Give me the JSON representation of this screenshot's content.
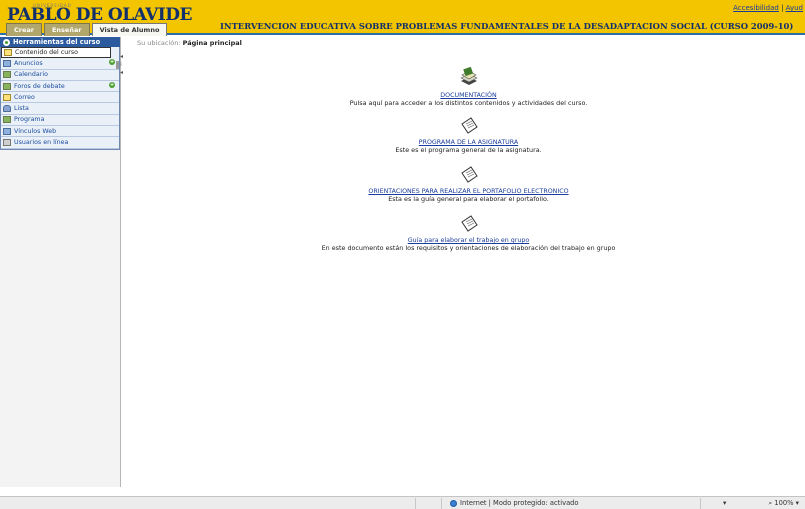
{
  "header": {
    "logo_small": "UNIVERSIDAD",
    "logo_text": "PABLO DE OLAVIDE",
    "accessibility": "Accesibilidad",
    "separator": "|",
    "help": "Ayud",
    "course_title": "INTERVENCION EDUCATIVA SOBRE PROBLEMAS FUNDAMENTALES DE LA DESADAPTACION SOCIAL (CURSO 2009-10)",
    "tabs": [
      {
        "label": "Crear",
        "active": false
      },
      {
        "label": "Enseñar",
        "active": false
      },
      {
        "label": "Vista de Alumno",
        "active": true
      }
    ]
  },
  "sidebar": {
    "heading": "Herramientas del curso",
    "items": [
      {
        "label": "Contenido del curso",
        "icon": "folder-icon",
        "selected": true
      },
      {
        "label": "Anuncios",
        "icon": "announcements-icon",
        "plus": true
      },
      {
        "label": "Calendario",
        "icon": "calendar-icon"
      },
      {
        "label": "Foros de debate",
        "icon": "forum-icon",
        "plus": true
      },
      {
        "label": "Correo",
        "icon": "mail-icon"
      },
      {
        "label": "Lista",
        "icon": "people-icon"
      },
      {
        "label": "Programa",
        "icon": "program-icon"
      },
      {
        "label": "Vínculos Web",
        "icon": "web-links-icon"
      },
      {
        "label": "Usuarios en línea",
        "icon": "online-users-icon"
      }
    ]
  },
  "content": {
    "breadcrumb_prefix": "Su ubicación:",
    "breadcrumb_current": "Página principal",
    "items": [
      {
        "link": "DOCUMENTACIÓN",
        "desc": "Pulsa aquí para acceder a los distintos contenidos y actividades del curso.",
        "icon": "documents-stack-icon"
      },
      {
        "link": "PROGRAMA DE LA ASIGNATURA",
        "desc": "Este es el programa general de la asignatura.",
        "icon": "document-icon"
      },
      {
        "link": "ORIENTACIONES PARA REALIZAR EL PORTAFOLIO ELECTRONICO",
        "desc": "Esta es la guía general para elaborar el portafolio.",
        "icon": "document-icon"
      },
      {
        "link": "Guía para elaborar el trabajo en grupo",
        "desc": "En este documento están los requisitos y orientaciones de elaboración del trabajo en grupo",
        "icon": "document-icon"
      }
    ]
  },
  "statusbar": {
    "zone": "Internet | Modo protegido: activado",
    "zoom": "100%"
  }
}
